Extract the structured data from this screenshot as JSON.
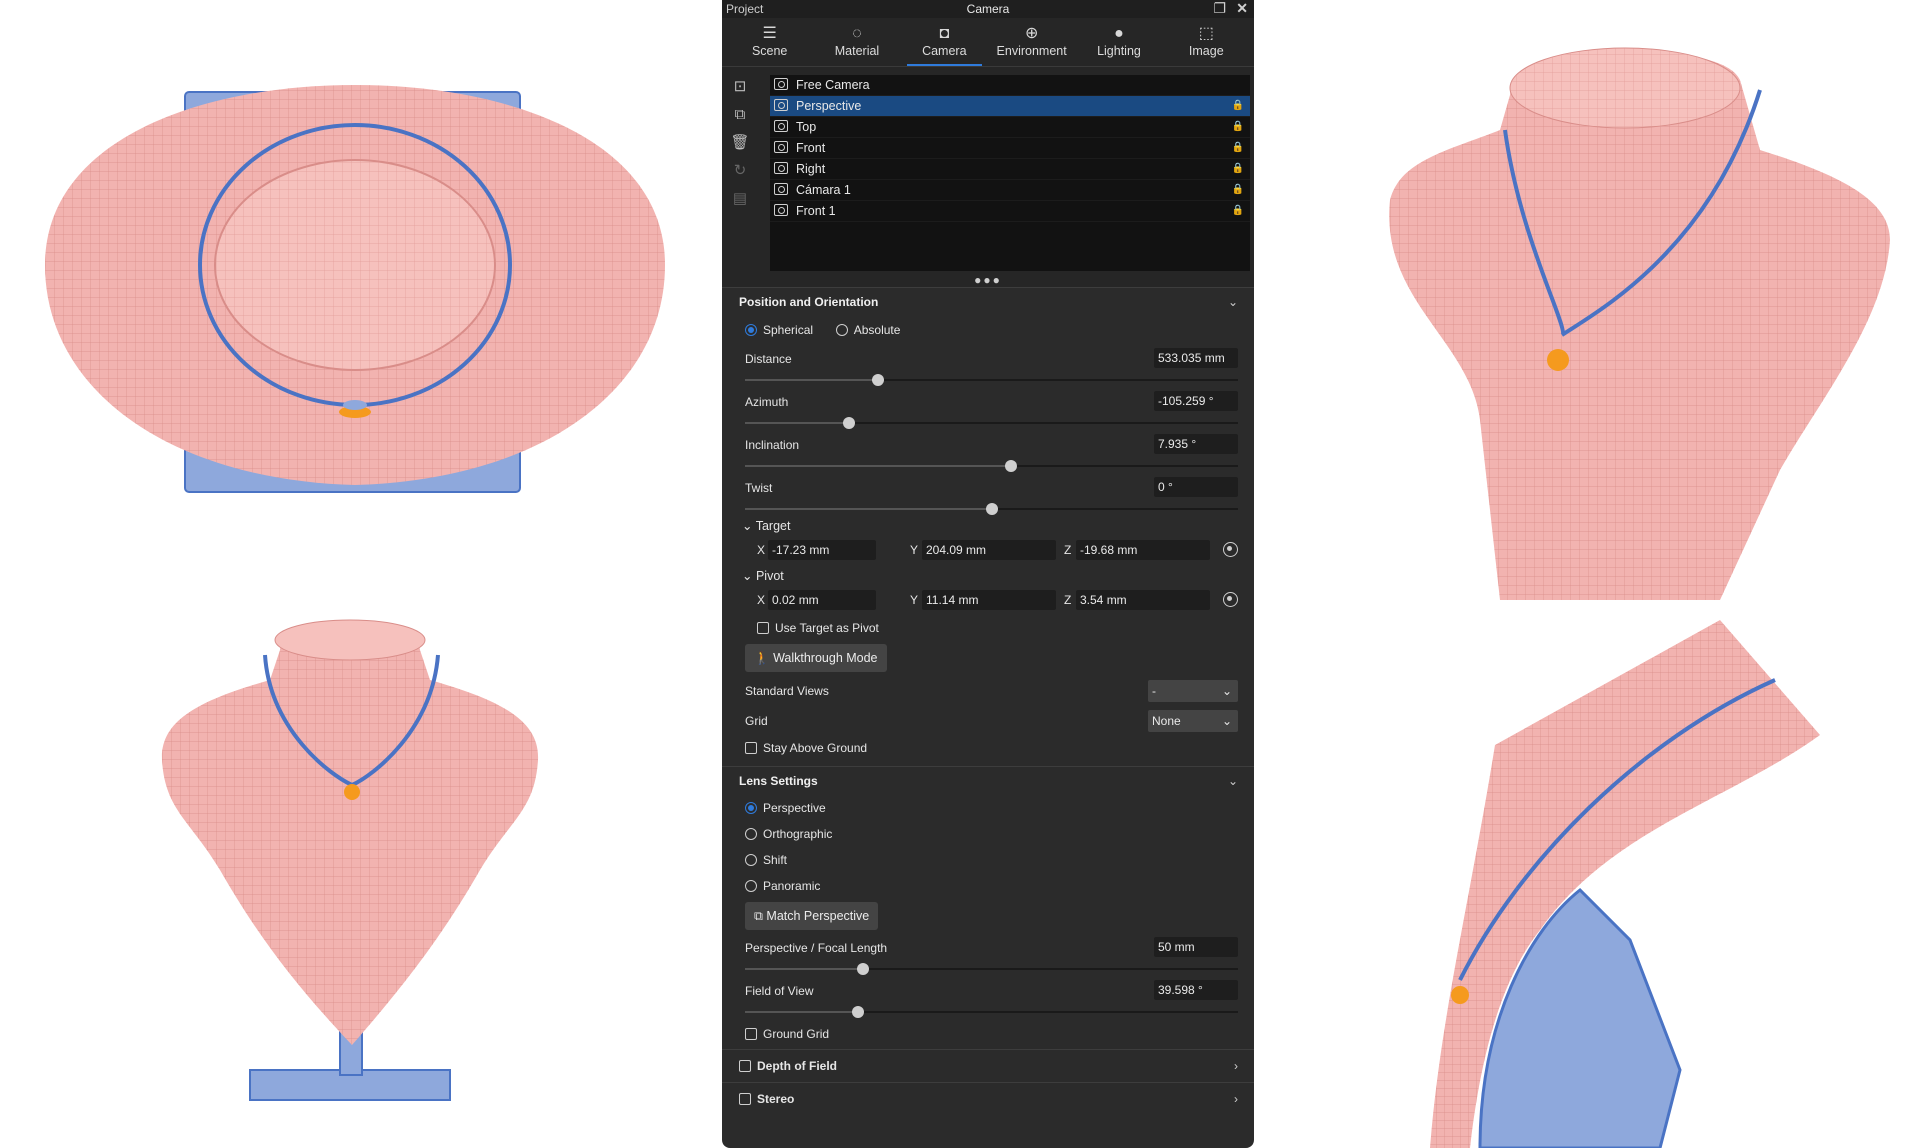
{
  "panel": {
    "project_label": "Project",
    "window_title": "Camera",
    "tabs": [
      {
        "label": "Scene",
        "icon": "scene-icon"
      },
      {
        "label": "Material",
        "icon": "material-icon"
      },
      {
        "label": "Camera",
        "icon": "camera-icon",
        "active": true
      },
      {
        "label": "Environment",
        "icon": "environment-icon"
      },
      {
        "label": "Lighting",
        "icon": "lighting-icon"
      },
      {
        "label": "Image",
        "icon": "image-icon"
      }
    ],
    "cameras": [
      {
        "name": "Free Camera",
        "locked": false
      },
      {
        "name": "Perspective",
        "locked": true,
        "selected": true
      },
      {
        "name": "Top",
        "locked": true
      },
      {
        "name": "Front",
        "locked": true
      },
      {
        "name": "Right",
        "locked": true
      },
      {
        "name": "Cámara 1",
        "locked": true
      },
      {
        "name": "Front 1",
        "locked": true
      }
    ],
    "position": {
      "title": "Position and Orientation",
      "spherical_label": "Spherical",
      "absolute_label": "Absolute",
      "mode": "Spherical",
      "distance": {
        "label": "Distance",
        "value": "533.035 mm",
        "level": 0.27
      },
      "azimuth": {
        "label": "Azimuth",
        "value": "-105.259 °",
        "level": 0.21
      },
      "inclination": {
        "label": "Inclination",
        "value": "7.935 °",
        "level": 0.54
      },
      "twist": {
        "label": "Twist",
        "value": "0 °",
        "level": 0.5
      },
      "target": {
        "label": "Target",
        "x": "-17.23 mm",
        "y": "204.09 mm",
        "z": "-19.68 mm"
      },
      "pivot": {
        "label": "Pivot",
        "x": "0.02 mm",
        "y": "11.14 mm",
        "z": "3.54 mm"
      },
      "axis_x": "X",
      "axis_y": "Y",
      "axis_z": "Z",
      "use_target_label": "Use Target as Pivot",
      "walkthrough_label": "Walkthrough Mode",
      "standard_views_label": "Standard Views",
      "standard_views_value": "-",
      "grid_label": "Grid",
      "grid_value": "None",
      "stay_above_label": "Stay Above Ground"
    },
    "lens": {
      "title": "Lens Settings",
      "options": [
        "Perspective",
        "Orthographic",
        "Shift",
        "Panoramic"
      ],
      "selected": "Perspective",
      "match_label": "Match Perspective",
      "focal": {
        "label": "Perspective / Focal Length",
        "value": "50 mm",
        "level": 0.24
      },
      "fov": {
        "label": "Field of View",
        "value": "39.598 °",
        "level": 0.23
      },
      "ground_grid_label": "Ground Grid"
    },
    "dof_label": "Depth of Field",
    "stereo_label": "Stereo"
  },
  "colors": {
    "bust_fill": "#f2b3b0",
    "bust_wire": "#d98d89",
    "necklace": "#4a73c4",
    "pendant": "#f59a1e",
    "stand": "#8ea8dc",
    "accent": "#2f7bdc"
  }
}
